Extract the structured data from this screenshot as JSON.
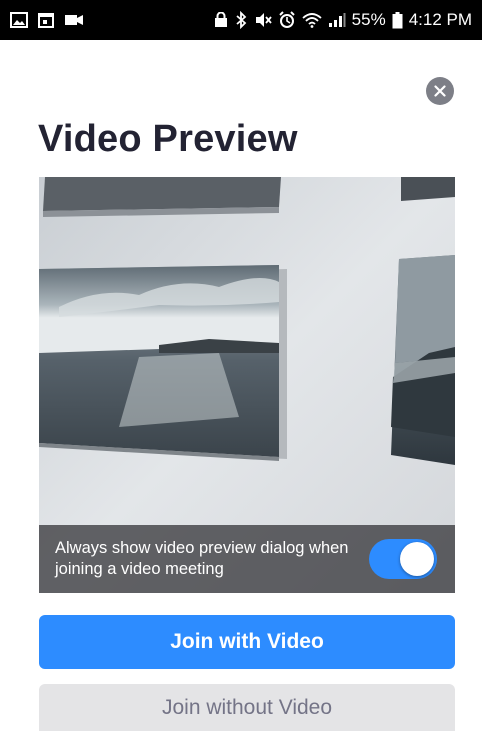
{
  "status_bar": {
    "battery": "55%",
    "time": "4:12 PM"
  },
  "dialog": {
    "title": "Video Preview",
    "overlay_text": "Always show video preview dialog when joining a video meeting",
    "toggle_on": true,
    "join_with_video": "Join with Video",
    "join_without_video": "Join without Video"
  },
  "colors": {
    "accent": "#2d8cff",
    "title": "#232333",
    "secondary_bg": "#e4e4e6",
    "secondary_text": "#747487"
  }
}
